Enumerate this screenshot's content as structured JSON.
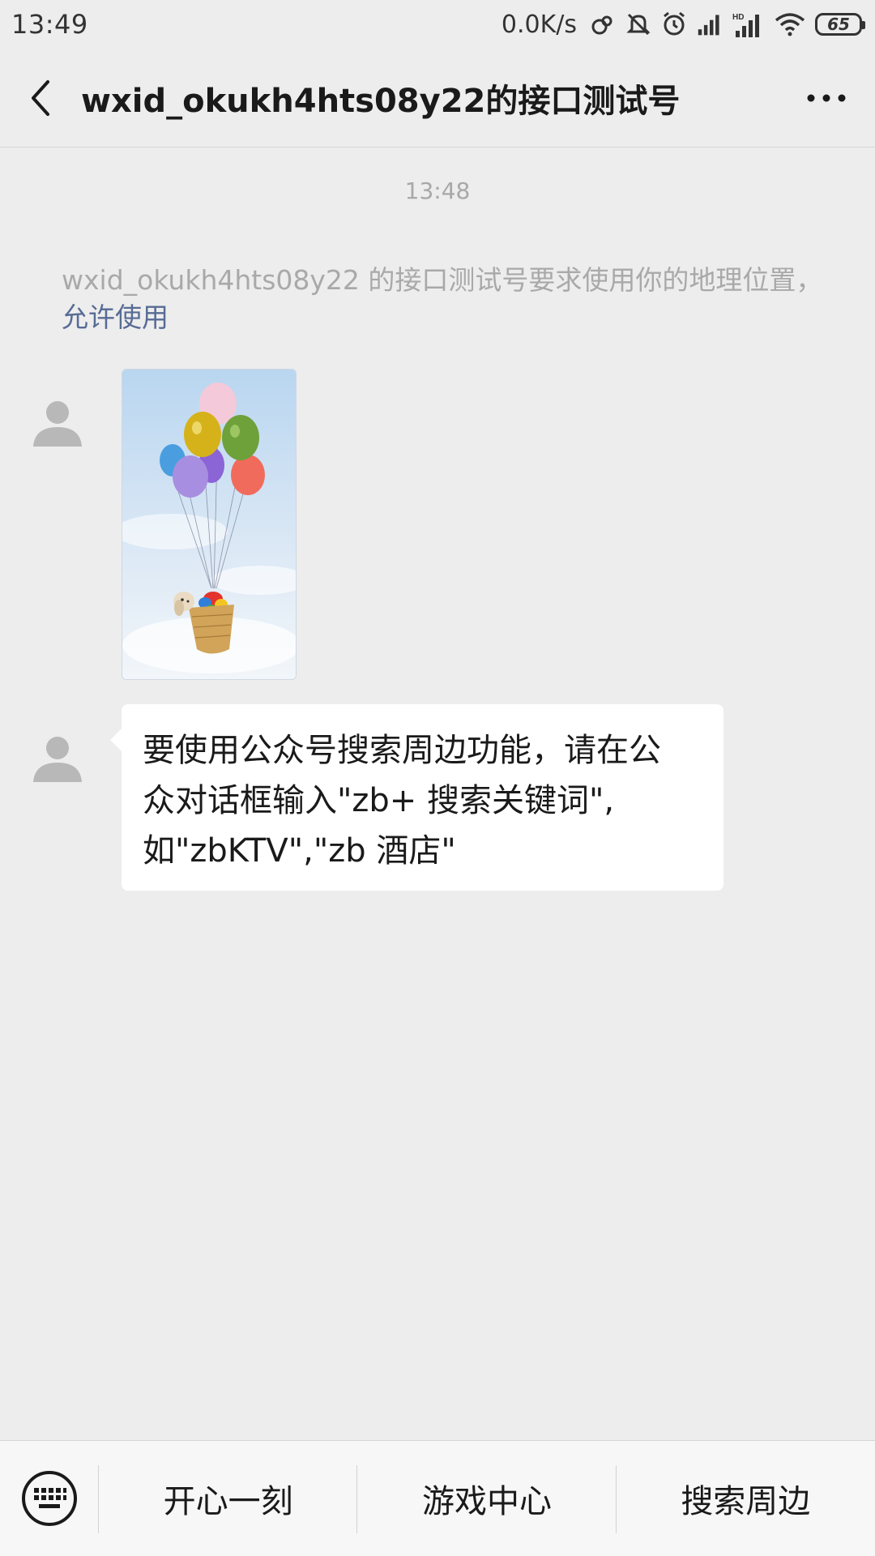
{
  "status_bar": {
    "time": "13:49",
    "net_speed": "0.0K/s",
    "battery": "65",
    "hd_label": "HD",
    "icons": [
      "link-icon",
      "mute-icon",
      "alarm-icon",
      "signal-icon",
      "hd-signal-icon",
      "wifi-icon",
      "battery-icon"
    ]
  },
  "header": {
    "title": "wxid_okukh4hts08y22的接口测试号",
    "back_icon": "chevron-left-icon",
    "more_icon": "more-dots-icon"
  },
  "chat": {
    "timestamp": "13:48",
    "system_message": {
      "text": "wxid_okukh4hts08y22 的接口测试号要求使用你的地理位置，",
      "link": "允许使用"
    },
    "messages": [
      {
        "type": "image",
        "description_icon": "balloon-photo"
      },
      {
        "type": "text",
        "lines": [
          "要使用公众号搜索周边功能，请在公",
          "众对话框输入\"zb+ 搜索关键词\",",
          "如\"zbKTV\",\"zb 酒店\""
        ]
      }
    ]
  },
  "bottom_menu": {
    "keyboard_icon": "keyboard-icon",
    "items": [
      "开心一刻",
      "游戏中心",
      "搜索周边"
    ]
  },
  "colors": {
    "background": "#ededed",
    "bubble": "#ffffff",
    "link": "#576b95",
    "system_text": "#a9a9a9"
  }
}
